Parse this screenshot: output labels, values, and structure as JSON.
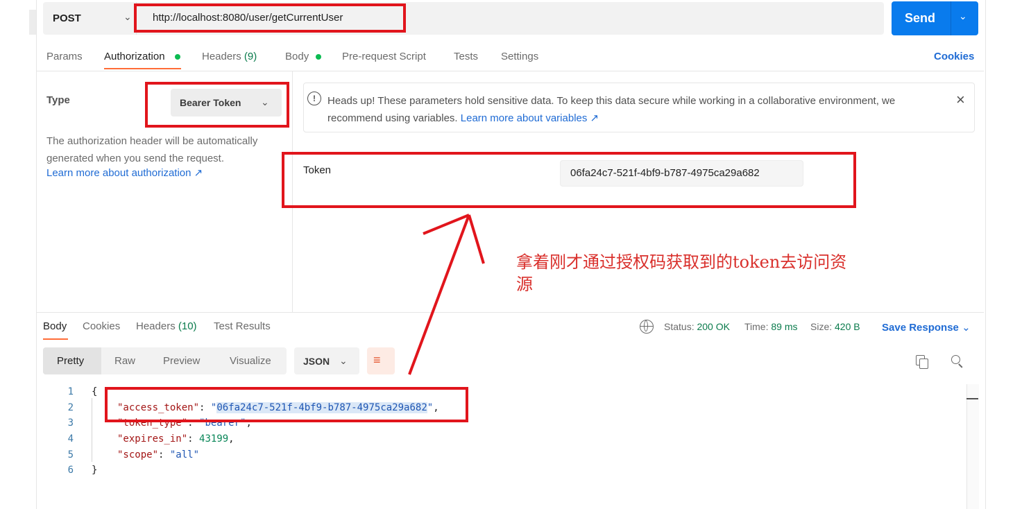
{
  "request": {
    "method": "POST",
    "url": "http://localhost:8080/user/getCurrentUser",
    "send_label": "Send"
  },
  "request_tabs": {
    "params": "Params",
    "authorization": "Authorization",
    "headers": "Headers",
    "headers_count": "(9)",
    "body": "Body",
    "prerequest": "Pre-request Script",
    "tests": "Tests",
    "settings": "Settings",
    "cookies": "Cookies"
  },
  "auth": {
    "type_label": "Type",
    "type_value": "Bearer Token",
    "description": "The authorization header will be automatically generated when you send the request.",
    "learn_more": "Learn more about authorization ↗"
  },
  "warning": {
    "text": "Heads up! These parameters hold sensitive data. To keep this data secure while working in a collaborative environment, we recommend using variables.",
    "link": "Learn more about variables ↗"
  },
  "token": {
    "label": "Token",
    "value": "06fa24c7-521f-4bf9-b787-4975ca29a682"
  },
  "annotation": "拿着刚才通过授权码获取到的token去访问资源",
  "response_tabs": {
    "body": "Body",
    "cookies": "Cookies",
    "headers": "Headers",
    "headers_count": "(10)",
    "test_results": "Test Results"
  },
  "response_status": {
    "status_label": "Status:",
    "status_value": "200 OK",
    "time_label": "Time:",
    "time_value": "89 ms",
    "size_label": "Size:",
    "size_value": "420 B",
    "save_response": "Save Response"
  },
  "view_modes": [
    "Pretty",
    "Raw",
    "Preview",
    "Visualize"
  ],
  "format": "JSON",
  "code": {
    "line_numbers": [
      "1",
      "2",
      "3",
      "4",
      "5",
      "6"
    ],
    "open_brace": "{",
    "close_brace": "}",
    "access_token_key": "\"access_token\"",
    "access_token_value": "06fa24c7-521f-4bf9-b787-4975ca29a682",
    "token_type_key": "\"token_type\"",
    "token_type_value": "\"bearer\"",
    "expires_in_key": "\"expires_in\"",
    "expires_in_value": "43199",
    "scope_key": "\"scope\"",
    "scope_value": "\"all\""
  },
  "colors": {
    "accent": "#097bed",
    "tab_indicator": "#ff6c37",
    "annotation_red": "#e1151c",
    "status_green": "#0a7b4c"
  },
  "icons": {
    "method_dropdown": "chevron-down-icon",
    "send_dropdown": "chevron-down-icon",
    "warning": "info-circle-icon",
    "close": "close-icon",
    "globe": "globe-icon",
    "wrap": "wrap-lines-icon",
    "copy": "copy-icon",
    "search": "search-icon"
  }
}
